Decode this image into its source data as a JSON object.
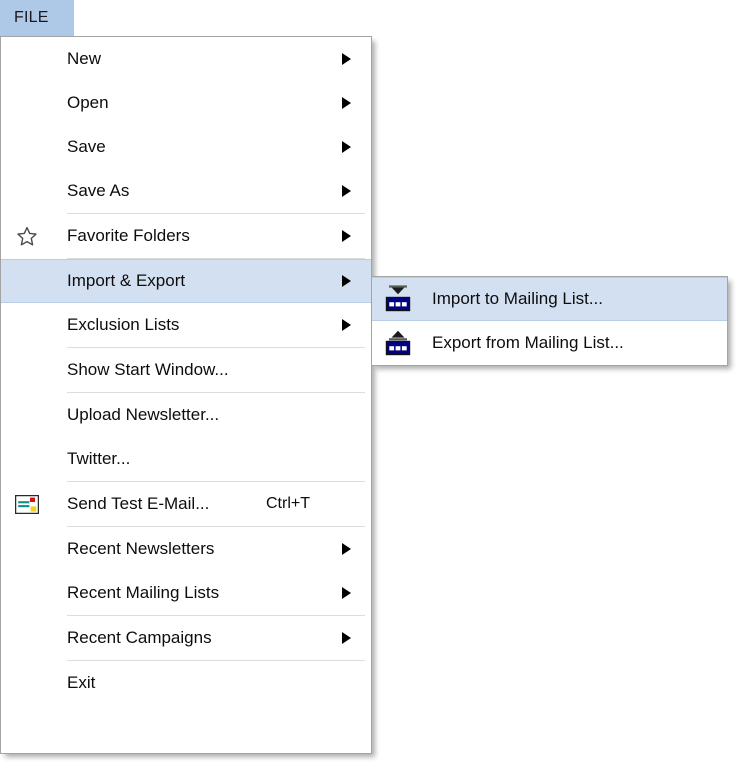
{
  "tab": {
    "label": "FILE",
    "background": "#aec8e8"
  },
  "colors": {
    "menu_background": "#ffffff",
    "menu_border": "#a4a4a4",
    "highlight": "#d3e0f2",
    "highlight_border": "#b9cde5",
    "separator": "#dcdcdc",
    "text": "#0d0d0d",
    "icon_navy": "#000080"
  },
  "file_menu": {
    "items": [
      {
        "label": "New",
        "icon": null,
        "submenu": true,
        "shortcut": "",
        "selected": false,
        "separator_after": false
      },
      {
        "label": "Open",
        "icon": null,
        "submenu": true,
        "shortcut": "",
        "selected": false,
        "separator_after": false
      },
      {
        "label": "Save",
        "icon": null,
        "submenu": true,
        "shortcut": "",
        "selected": false,
        "separator_after": false
      },
      {
        "label": "Save As",
        "icon": null,
        "submenu": true,
        "shortcut": "",
        "selected": false,
        "separator_after": true
      },
      {
        "label": "Favorite Folders",
        "icon": "star-icon",
        "submenu": true,
        "shortcut": "",
        "selected": false,
        "separator_after": true
      },
      {
        "label": "Import & Export",
        "icon": null,
        "submenu": true,
        "shortcut": "",
        "selected": true,
        "separator_after": false
      },
      {
        "label": "Exclusion Lists",
        "icon": null,
        "submenu": true,
        "shortcut": "",
        "selected": false,
        "separator_after": true
      },
      {
        "label": "Show Start Window...",
        "icon": null,
        "submenu": false,
        "shortcut": "",
        "selected": false,
        "separator_after": true
      },
      {
        "label": "Upload Newsletter...",
        "icon": null,
        "submenu": false,
        "shortcut": "",
        "selected": false,
        "separator_after": false
      },
      {
        "label": "Twitter...",
        "icon": null,
        "submenu": false,
        "shortcut": "",
        "selected": false,
        "separator_after": true
      },
      {
        "label": "Send Test E-Mail...",
        "icon": "mail-icon",
        "submenu": false,
        "shortcut": "Ctrl+T",
        "selected": false,
        "separator_after": true
      },
      {
        "label": "Recent Newsletters",
        "icon": null,
        "submenu": true,
        "shortcut": "",
        "selected": false,
        "separator_after": false
      },
      {
        "label": "Recent Mailing Lists",
        "icon": null,
        "submenu": true,
        "shortcut": "",
        "selected": false,
        "separator_after": true
      },
      {
        "label": "Recent Campaigns",
        "icon": null,
        "submenu": true,
        "shortcut": "",
        "selected": false,
        "separator_after": true
      },
      {
        "label": "Exit",
        "icon": null,
        "submenu": false,
        "shortcut": "",
        "selected": false,
        "separator_after": false
      }
    ]
  },
  "submenu": {
    "parent": "Import & Export",
    "items": [
      {
        "label": "Import to Mailing List...",
        "icon": "import-table-icon",
        "selected": true
      },
      {
        "label": "Export from Mailing List...",
        "icon": "export-table-icon",
        "selected": false
      }
    ]
  }
}
